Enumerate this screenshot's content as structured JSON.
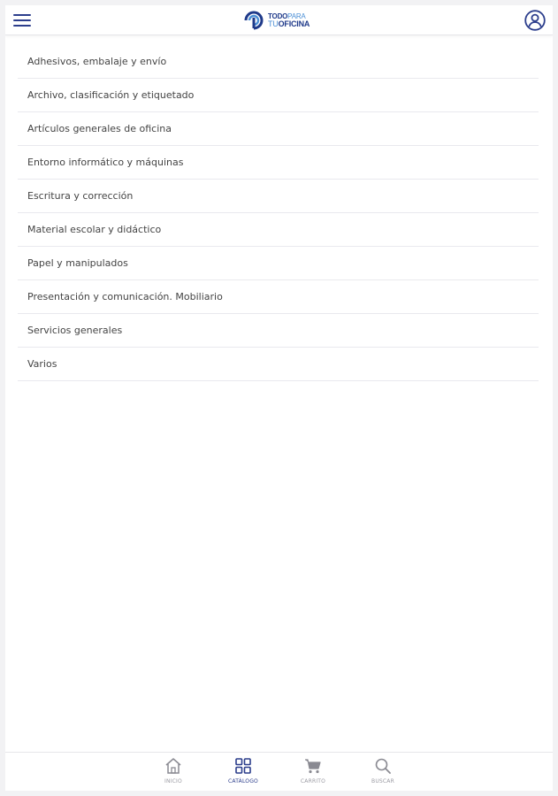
{
  "app": {
    "logo_line1_bold": "TODO",
    "logo_line1_thin": "PARA",
    "logo_line2_thin": "TU",
    "logo_line2_bold": "OFICINA"
  },
  "header": {
    "menu_icon": "hamburger-menu-icon",
    "user_icon": "user-account-icon"
  },
  "catalog": {
    "categories": [
      "Adhesivos, embalaje y envío",
      "Archivo, clasificación y etiquetado",
      "Artículos generales de oficina",
      "Entorno informático y máquinas",
      "Escritura y corrección",
      "Material escolar y didáctico",
      "Papel y manipulados",
      "Presentación y comunicación. Mobiliario",
      "Servicios generales",
      "Varios"
    ]
  },
  "bottom_nav": {
    "items": [
      {
        "label": "INICIO",
        "icon": "home-icon"
      },
      {
        "label": "CATÁLOGO",
        "icon": "grid-icon",
        "active": true
      },
      {
        "label": "CARRITO",
        "icon": "cart-icon"
      },
      {
        "label": "BUSCAR",
        "icon": "search-icon"
      }
    ]
  },
  "colors": {
    "brand": "#2c3e8c",
    "brand_light": "#4b8fd6",
    "inactive": "#9a9aa2"
  }
}
